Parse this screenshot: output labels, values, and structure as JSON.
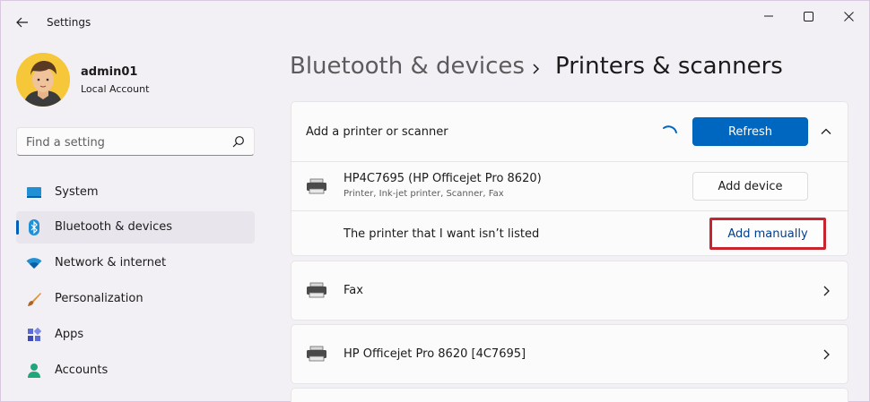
{
  "window": {
    "app_title": "Settings"
  },
  "profile": {
    "name": "admin01",
    "account_type": "Local Account"
  },
  "search": {
    "placeholder": "Find a setting"
  },
  "sidebar": {
    "items": [
      {
        "label": "System",
        "icon": "system-icon"
      },
      {
        "label": "Bluetooth & devices",
        "icon": "bluetooth-icon",
        "active": true
      },
      {
        "label": "Network & internet",
        "icon": "wifi-icon"
      },
      {
        "label": "Personalization",
        "icon": "brush-icon"
      },
      {
        "label": "Apps",
        "icon": "apps-icon"
      },
      {
        "label": "Accounts",
        "icon": "person-icon"
      }
    ]
  },
  "header": {
    "breadcrumb": "Bluetooth & devices",
    "title": "Printers & scanners"
  },
  "add_section": {
    "label": "Add a printer or scanner",
    "refresh_label": "Refresh",
    "found_device": {
      "name": "HP4C7695 (HP Officejet Pro 8620)",
      "details": "Printer, Ink-jet printer, Scanner, Fax",
      "button_label": "Add device"
    },
    "not_listed": {
      "label": "The printer that I want isn’t listed",
      "button_label": "Add manually"
    }
  },
  "printers": [
    {
      "name": "Fax"
    },
    {
      "name": "HP Officejet Pro 8620 [4C7695]"
    }
  ],
  "colors": {
    "accent": "#0067c0",
    "highlight_border": "#c8242f"
  }
}
